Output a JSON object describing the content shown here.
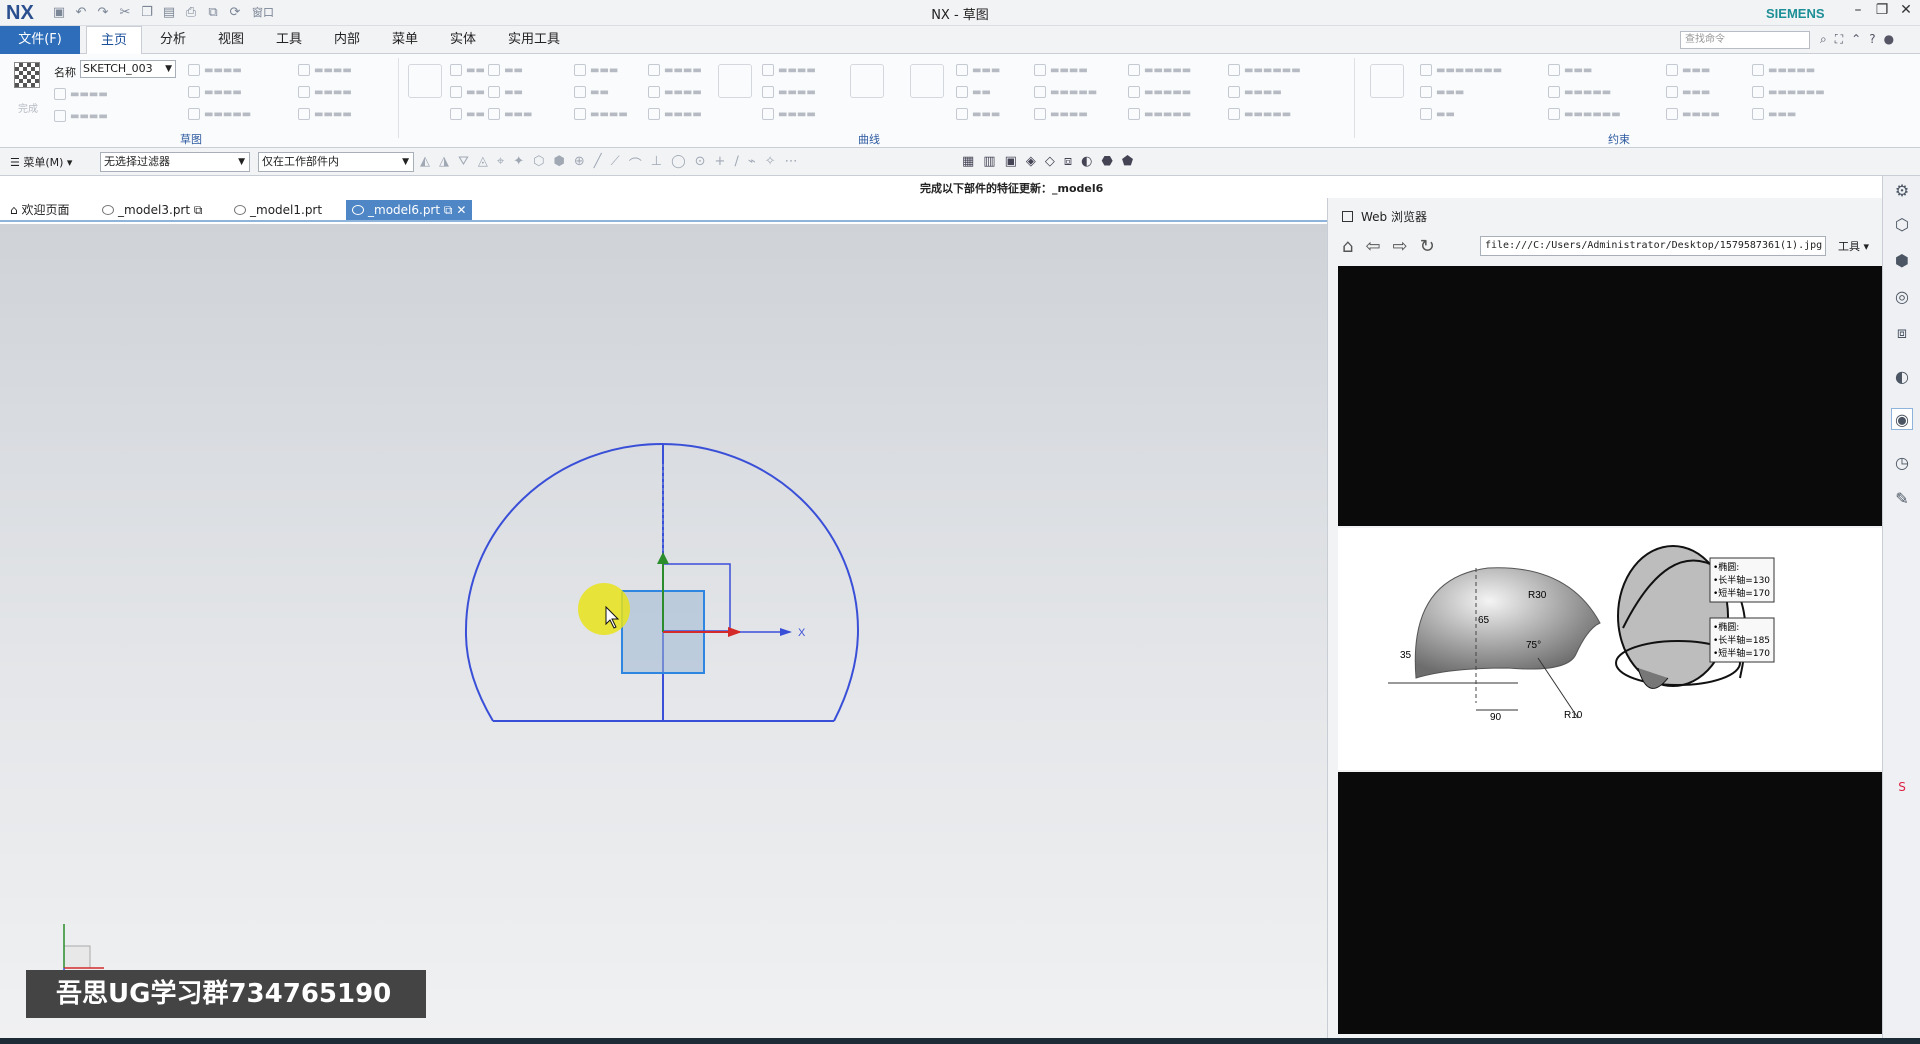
{
  "titlebar": {
    "logo": "NX",
    "title": "NX - 草图",
    "brand": "SIEMENS",
    "window_menu": "窗口"
  },
  "ribbon_tabs": [
    "文件(F)",
    "主页",
    "分析",
    "视图",
    "工具",
    "内部",
    "菜单",
    "实体",
    "实用工具"
  ],
  "active_tab": "主页",
  "command_search_placeholder": "查找命令",
  "ribbon": {
    "sketch_name_label": "名称",
    "sketch_name": "SKETCH_003",
    "finish_label": "完成",
    "groups": [
      "草图",
      "曲线",
      "约束"
    ]
  },
  "filterbar": {
    "menu": "菜单(M)",
    "type_filter": "无选择过滤器",
    "scope_filter": "仅在工作部件内"
  },
  "status_message": "完成以下部件的特征更新：_model6",
  "doc_tabs": [
    {
      "label": "欢迎页面",
      "active": false
    },
    {
      "label": "_model3.prt",
      "active": false
    },
    {
      "label": "_model1.prt",
      "active": false
    },
    {
      "label": "_model6.prt",
      "active": true
    }
  ],
  "sketch": {
    "x_label": "X",
    "watermark": "吾思UG学习群734765190"
  },
  "web_browser": {
    "title": "Web 浏览器",
    "url": "file:///C:/Users/Administrator/Desktop/1579587361(1).jpg",
    "tools_label": "工具",
    "figure": {
      "dims": [
        "35",
        "65",
        "R30",
        "75°",
        "90",
        "R10"
      ],
      "notes_top": [
        "•椭圆:",
        "•长半轴=130",
        "•短半轴=170"
      ],
      "notes_bottom": [
        "•椭圆:",
        "•长半轴=185",
        "•短半轴=170"
      ]
    }
  },
  "colors": {
    "accent": "#2d6dba",
    "sketch_curve": "#3a4fd8",
    "brand": "#1d8f96"
  }
}
